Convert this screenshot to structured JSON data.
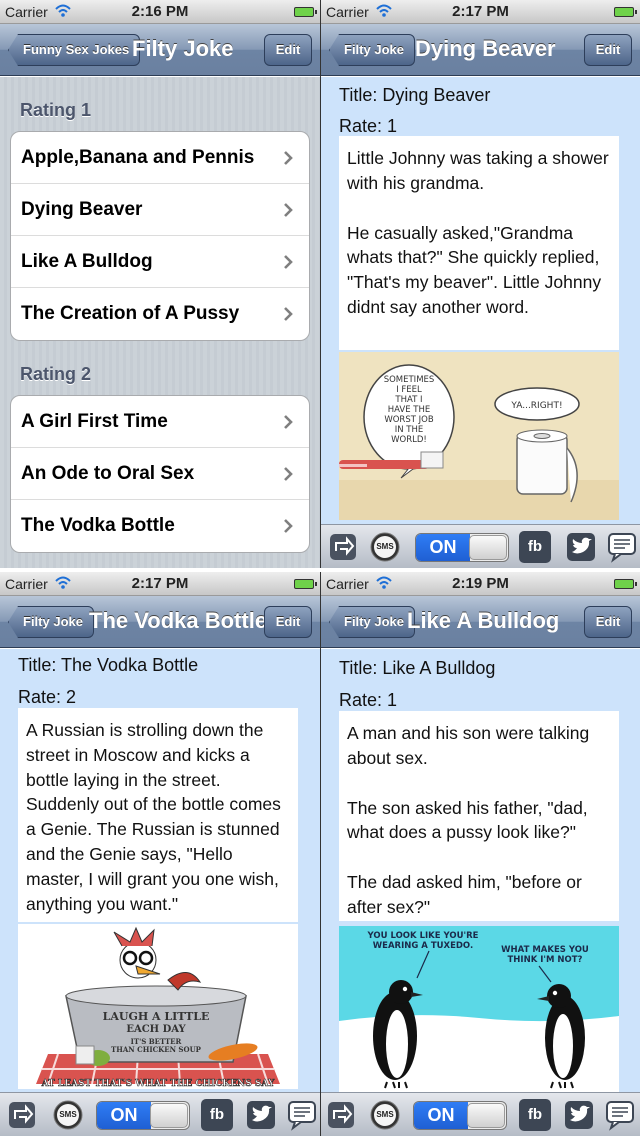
{
  "statusbar": {
    "carrier": "Carrier",
    "times": [
      "2:16 PM",
      "2:17 PM",
      "2:17 PM",
      "2:19 PM"
    ]
  },
  "list_screen": {
    "back_label": "Funny Sex Jokes",
    "title": "Filty Joke",
    "edit_label": "Edit",
    "sections": [
      {
        "header": "Rating 1",
        "items": [
          "Apple,Banana and Pennis",
          "Dying Beaver",
          "Like A Bulldog",
          "The Creation of A Pussy"
        ]
      },
      {
        "header": "Rating 2",
        "items": [
          "A Girl First Time",
          "An Ode to Oral Sex",
          "The Vodka Bottle"
        ]
      }
    ]
  },
  "detail_screens": [
    {
      "back_label": "Filty Joke",
      "nav_title": "Dying Beaver",
      "edit_label": "Edit",
      "title_line": "Title: Dying Beaver",
      "rate_line": "Rate: 1",
      "paragraphs": [
        "Little Johnny was taking a shower with his grandma.",
        "He casually asked,\"Grandma whats that?\" She quickly replied, \"That's my beaver\". Little Johnny didnt say another word."
      ],
      "cartoon": {
        "speech_left": [
          "SOMETIMES",
          "I FEEL",
          "THAT I",
          "HAVE THE",
          "WORST JOB",
          "IN THE",
          "WORLD!"
        ],
        "speech_right": "YA...RIGHT!"
      }
    },
    {
      "back_label": "Filty Joke",
      "nav_title": "The Vodka Bottle",
      "edit_label": "Edit",
      "title_line": "Title: The Vodka Bottle",
      "rate_line": "Rate: 2",
      "paragraphs": [
        "A Russian is strolling down the street in Moscow and kicks a bottle laying in the street. Suddenly out of the bottle comes a Genie. The Russian is stunned and the Genie says, \"Hello master, I will grant you one wish, anything you want.\""
      ],
      "cartoon": {
        "pot_text": [
          "LAUGH A LITTLE",
          "EACH DAY"
        ],
        "small_text": [
          "IT'S BETTER",
          "THAN CHICKEN SOUP"
        ],
        "caption": "AT LEAST THAT'S WHAT THE CHICKENS SAY"
      }
    },
    {
      "back_label": "Filty Joke",
      "nav_title": "Like A Bulldog",
      "edit_label": "Edit",
      "title_line": "Title: Like A Bulldog",
      "rate_line": "Rate: 1",
      "paragraphs": [
        "A man and his son were talking about sex.",
        "The son asked his father, \"dad, what does a pussy look like?\"",
        "The dad asked him, \"before or after sex?\""
      ],
      "cartoon": {
        "speech_left": [
          "YOU LOOK LIKE YOU'RE",
          "WEARING A TUXEDO."
        ],
        "speech_right": [
          "WHAT MAKES YOU",
          "THINK I'M NOT?"
        ]
      }
    }
  ],
  "toolbar": {
    "sms_label": "SMS",
    "toggle_label": "ON",
    "fb_label": "fb"
  },
  "colors": {
    "nav_blue": "#6d84a4",
    "detail_bg": "#cde3fb",
    "toggle_blue": "#2f7df5"
  }
}
